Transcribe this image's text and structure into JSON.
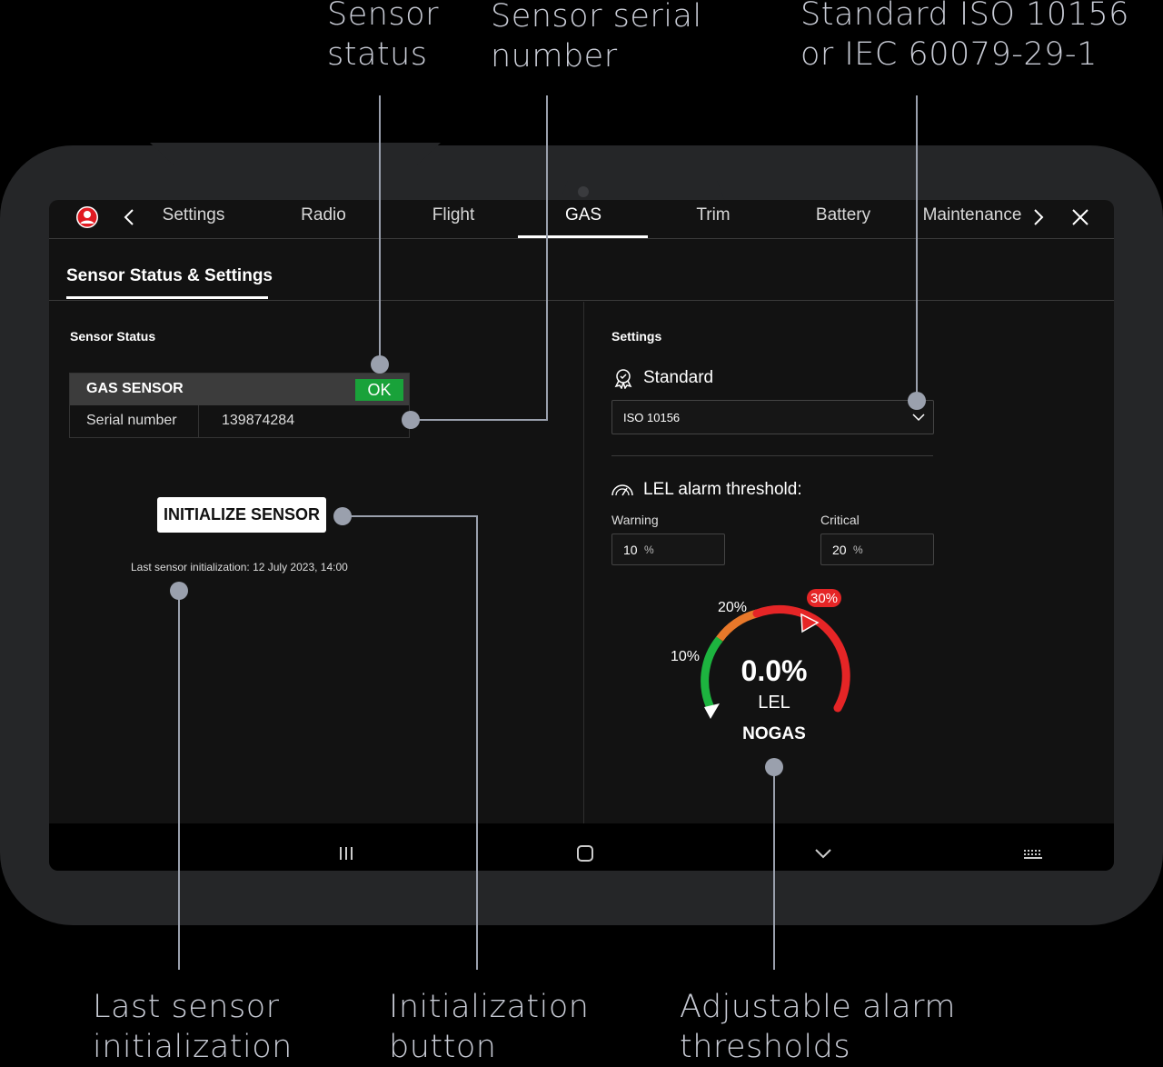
{
  "callouts": {
    "sensor_status": "Sensor\nstatus",
    "serial_number": "Sensor serial\nnumber",
    "standard": "Standard ISO 10156\nor IEC 60079-29-1",
    "last_init": "Last sensor\ninitialization",
    "init_button": "Initialization\nbutton",
    "thresholds": "Adjustable alarm\nthresholds"
  },
  "tabs": [
    "Settings",
    "Radio",
    "Flight",
    "GAS",
    "Trim",
    "Battery",
    "Maintenance"
  ],
  "active_tab": "GAS",
  "subtab": "Sensor Status & Settings",
  "sensor_status": {
    "title": "Sensor Status",
    "gas_sensor_label": "GAS SENSOR",
    "status": "OK",
    "serial_label": "Serial number",
    "serial_value": "139874284",
    "init_button": "INITIALIZE SENSOR",
    "last_init": "Last sensor initialization: 12 July 2023, 14:00"
  },
  "settings": {
    "title": "Settings",
    "standard_label": "Standard",
    "standard_value": "ISO 10156",
    "lel_label": "LEL alarm threshold:",
    "warning_label": "Warning",
    "warning_value": "10",
    "critical_label": "Critical",
    "critical_value": "20",
    "unit": "%"
  },
  "gauge": {
    "value": "0.0%",
    "unit": "LEL",
    "status": "NOGAS",
    "tick_10": "10%",
    "tick_20": "20%",
    "tick_30": "30%",
    "level": 0.0,
    "colors": {
      "green": "#1db43f",
      "orange": "#e8782a",
      "red": "#e52526"
    }
  },
  "colors": {
    "ok": "#19a23a",
    "callout": "#9aa0ad",
    "frame": "#252628"
  }
}
